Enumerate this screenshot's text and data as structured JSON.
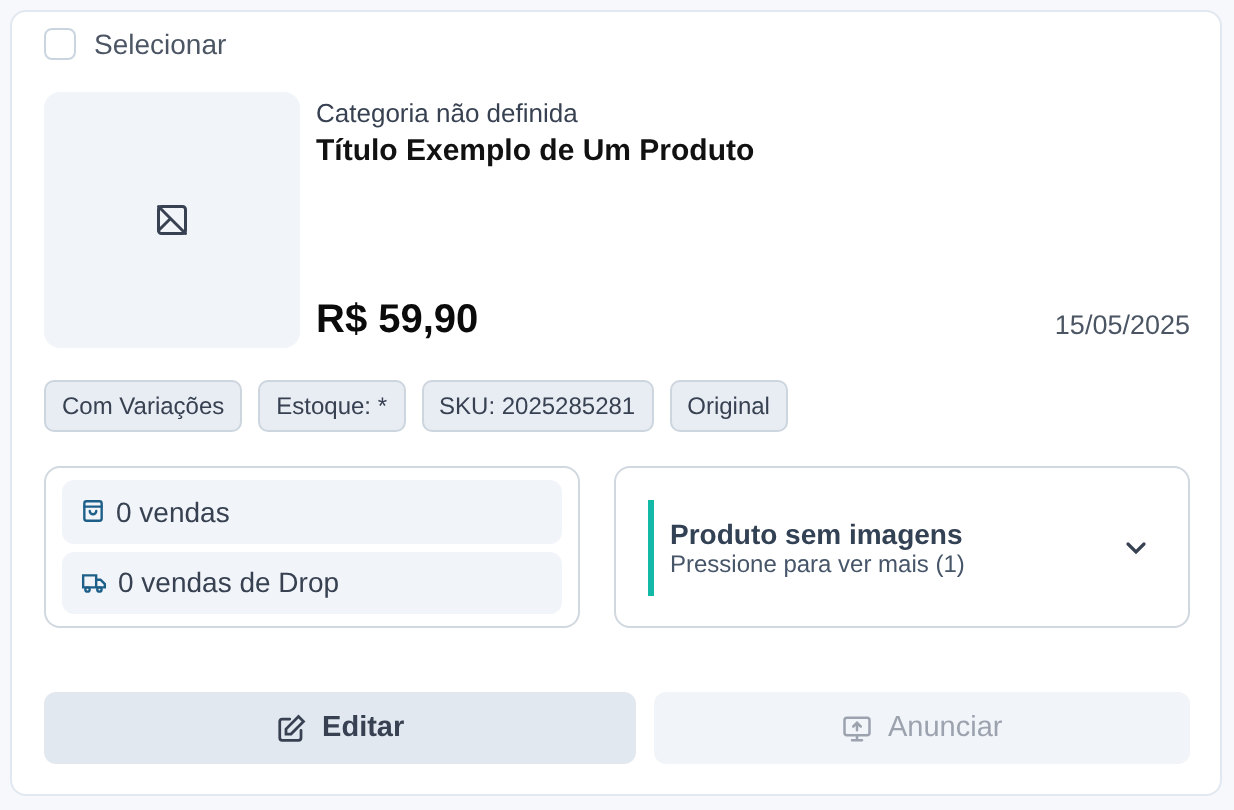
{
  "select": {
    "label": "Selecionar",
    "checked": false
  },
  "product": {
    "category": "Categoria não definida",
    "title": "Título Exemplo de Um Produto",
    "price": "R$ 59,90",
    "date": "15/05/2025"
  },
  "tags": [
    "Com Variações",
    "Estoque: *",
    "SKU: 2025285281",
    "Original"
  ],
  "stats": [
    {
      "kind": "bag",
      "text": "0 vendas"
    },
    {
      "kind": "truck",
      "text": "0 vendas de Drop"
    }
  ],
  "notice": {
    "title": "Produto sem imagens",
    "subtitle": "Pressione para ver mais (1)",
    "expanded": false
  },
  "buttons": [
    {
      "kind": "edit",
      "label": "Editar",
      "disabled": false
    },
    {
      "kind": "publish",
      "label": "Anunciar",
      "disabled": true
    }
  ]
}
